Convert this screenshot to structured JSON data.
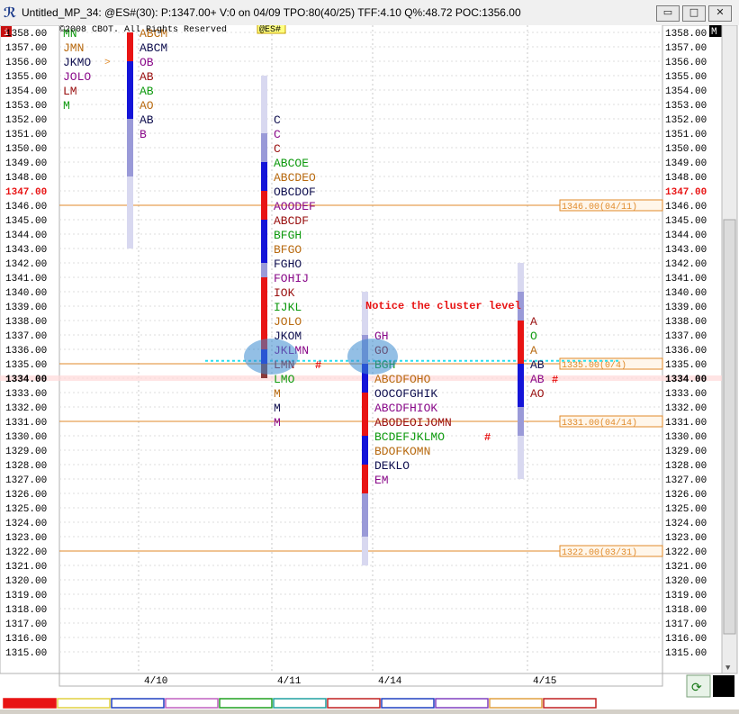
{
  "window": {
    "title": "Untitled_MP_34: @ES#(30): P:1347.00+ V:0 on 04/09 TPO:80(40/25) TFF:4.10 Q%:48.72 POC:1356.00",
    "minimize_label": "▭",
    "maximize_label": "□",
    "close_label": "✕"
  },
  "header": {
    "info_badge": "i",
    "copyright": "©2008 CBOT. All Rights Reserved",
    "symbol": "@ES#",
    "corner_badge": "M"
  },
  "chart_data": {
    "type": "market-profile",
    "price_axis": {
      "min": 1315,
      "max": 1358,
      "step": 1,
      "current_price": 1347.0,
      "highlight_price": 1334.0,
      "decimals": 2
    },
    "dates": [
      "4/10",
      "4/11",
      "4/14",
      "4/15"
    ],
    "profiles": [
      {
        "date": "4/10",
        "rows": [
          [
            1358,
            "MN"
          ],
          [
            1357,
            "JMN"
          ],
          [
            1356,
            "JKMO"
          ],
          [
            1355,
            "JOLO"
          ],
          [
            1354,
            "LM"
          ],
          [
            1353,
            "M"
          ]
        ],
        "poc_marker": 1356
      },
      {
        "date": "4/10b",
        "rows": [
          [
            1358,
            "ABCM"
          ],
          [
            1357,
            "ABCM"
          ],
          [
            1356,
            "OB"
          ],
          [
            1355,
            "AB"
          ],
          [
            1354,
            "AB"
          ],
          [
            1353,
            "AO"
          ],
          [
            1352,
            "AB"
          ],
          [
            1351,
            "B"
          ]
        ]
      },
      {
        "date": "4/11",
        "rows": [
          [
            1352,
            "C"
          ],
          [
            1351,
            "C"
          ],
          [
            1350,
            "C"
          ],
          [
            1349,
            "ABCOE"
          ],
          [
            1348,
            "ABCDEO"
          ],
          [
            1347,
            "OBCDOF"
          ],
          [
            1346,
            "AOODEF"
          ],
          [
            1345,
            "ABCDF"
          ],
          [
            1344,
            "BFGH"
          ],
          [
            1343,
            "BFGO"
          ],
          [
            1342,
            "FGHO"
          ],
          [
            1341,
            "FOHIJ"
          ],
          [
            1340,
            "IOK"
          ],
          [
            1339,
            "IJKL"
          ],
          [
            1338,
            "JOLO"
          ],
          [
            1337,
            "JKOM"
          ],
          [
            1336,
            "JKLMN"
          ],
          [
            1335,
            "LMN"
          ],
          [
            1334,
            "LMO"
          ],
          [
            1333,
            "M"
          ],
          [
            1332,
            "M"
          ],
          [
            1331,
            "M"
          ]
        ],
        "close_marker": 1335
      },
      {
        "date": "4/14",
        "rows": [
          [
            1337,
            "GH"
          ],
          [
            1336,
            "GO"
          ],
          [
            1335,
            "BGH"
          ],
          [
            1334,
            "ABCDFOHO"
          ],
          [
            1333,
            "OOCOFGHIK"
          ],
          [
            1332,
            "ABCDFHIOK"
          ],
          [
            1331,
            "ABODEOIJOMN"
          ],
          [
            1330,
            "BCDEFJKLMO"
          ],
          [
            1329,
            "BDOFKOMN"
          ],
          [
            1328,
            "DEKLO"
          ],
          [
            1327,
            "EM"
          ]
        ],
        "close_marker": 1330
      },
      {
        "date": "4/15",
        "rows": [
          [
            1338,
            "A"
          ],
          [
            1337,
            "O"
          ],
          [
            1336,
            "A"
          ],
          [
            1335,
            "AB"
          ],
          [
            1334,
            "AB"
          ],
          [
            1333,
            "AO"
          ]
        ],
        "close_marker": 1334
      }
    ],
    "reference_lines": [
      {
        "price": 1346.0,
        "label": "1346.00(04/11)"
      },
      {
        "price": 1335.0,
        "label": "1335.00(0/4)"
      },
      {
        "price": 1331.0,
        "label": "1331.00(04/14)"
      },
      {
        "price": 1322.0,
        "label": "1322.00(03/31)"
      }
    ],
    "annotation": {
      "text": "Notice the cluster level",
      "price": 1335.2
    },
    "colors": {
      "ref_line": "#e08a2a",
      "cyan_line": "#28e0ee",
      "red": "#e81414",
      "blue": "#1414d8",
      "highlight": "#ffd8d8",
      "green": "#0e9a0e",
      "orange": "#b86a10",
      "dark": "#101050",
      "purple": "#8a0a8a",
      "maroon": "#9a1010"
    }
  }
}
